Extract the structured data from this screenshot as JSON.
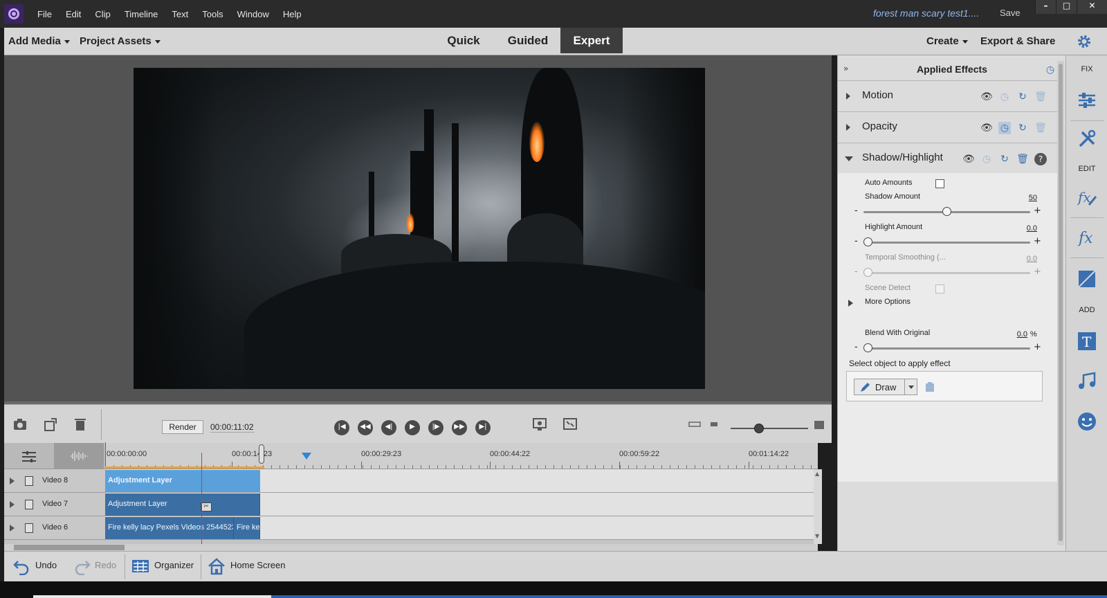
{
  "app": {
    "menu": [
      "File",
      "Edit",
      "Clip",
      "Timeline",
      "Text",
      "Tools",
      "Window",
      "Help"
    ],
    "document_title": "forest man scary test1....",
    "save_label": "Save"
  },
  "toolbar": {
    "add_media": "Add Media",
    "project_assets": "Project Assets",
    "modes": [
      "Quick",
      "Guided",
      "Expert"
    ],
    "active_mode": "Expert",
    "create": "Create",
    "export_share": "Export & Share"
  },
  "timeline_controls": {
    "render_label": "Render",
    "timecode": "00:00:11:02",
    "zoom_level": 0.35
  },
  "ruler": {
    "labels": [
      "00:00:00:00",
      "00:00:14:23",
      "00:00:29:23",
      "00:00:44:22",
      "00:00:59:22",
      "00:01:14:22"
    ]
  },
  "tracks": [
    {
      "name": "Video 8",
      "clips": [
        {
          "label": "Adjustment Layer",
          "style": "light"
        }
      ]
    },
    {
      "name": "Video 7",
      "clips": [
        {
          "label": "Adjustment Layer",
          "style": "dark"
        }
      ]
    },
    {
      "name": "Video 6",
      "clips": [
        {
          "label": "Fire kelly lacy Pexels Videos 2544523",
          "style": "dark"
        },
        {
          "label": "Fire ke",
          "style": "dark"
        }
      ]
    }
  ],
  "bottom_bar": {
    "undo": "Undo",
    "redo": "Redo",
    "organizer": "Organizer",
    "home_screen": "Home Screen"
  },
  "applied_effects": {
    "title": "Applied Effects",
    "effects": [
      "Motion",
      "Opacity",
      "Shadow/Highlight"
    ],
    "params": {
      "auto_amounts": "Auto Amounts",
      "shadow_amount_label": "Shadow Amount",
      "shadow_amount_value": "50",
      "shadow_amount_level": 0.5,
      "highlight_amount_label": "Highlight Amount",
      "highlight_amount_value": "0.0",
      "highlight_amount_level": 0.0,
      "temporal_smoothing_label": "Temporal Smoothing (...",
      "temporal_smoothing_value": "0.0",
      "temporal_smoothing_level": 0.0,
      "scene_detect": "Scene Detect",
      "more_options": "More Options",
      "blend_label": "Blend With Original",
      "blend_value": "0.0",
      "blend_unit": "%",
      "blend_level": 0.0
    },
    "select_object": "Select object to apply effect",
    "draw_label": "Draw"
  },
  "tool_rail": {
    "fix": "FIX",
    "edit": "EDIT",
    "add": "ADD"
  },
  "colors": {
    "accent_blue": "#3a6fb0",
    "clip_light": "#5aa1dc",
    "clip_dark": "#3b6fa4",
    "playhead": "#e03030",
    "work_area": "#f0a030",
    "doc_title": "#8fb7ef"
  }
}
